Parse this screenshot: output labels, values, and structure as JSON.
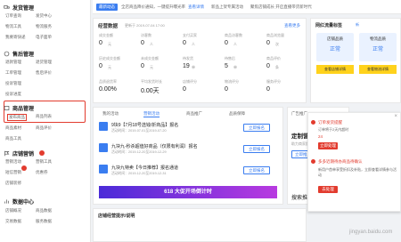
{
  "sidebar": {
    "sections": [
      {
        "title": "发货管理",
        "items": [
          "订单查询",
          "发货中心",
          "物流工具",
          "物流服务",
          "我要寄快递",
          "电子面单"
        ]
      },
      {
        "title": "售后管理",
        "items": [
          "退款管理",
          "退货管理",
          "工单管理",
          "售后评价",
          "投诉管理",
          "投诉进度"
        ]
      },
      {
        "title": "商品管理",
        "items": [
          "发布商品",
          "商品列表",
          "商品素材",
          "商品评价",
          "商品工具"
        ]
      },
      {
        "title": "店铺营销",
        "items": [
          "营销活动",
          "营销工具",
          "短信营销",
          "优惠券",
          "店铺装修"
        ]
      },
      {
        "title": "数据中心",
        "items": [
          "店铺概况",
          "商品数据",
          "交易数据",
          "服务数据"
        ]
      }
    ]
  },
  "topbar": {
    "tag": "最新动态",
    "text": "全店商品降价通知，一键提升曝光率",
    "link": "查看详情",
    "extra": "新品上架专属活动",
    "right": "聚焦店铺成长 开启直播带货新时代"
  },
  "overview": {
    "title": "经营数据",
    "time": "更新于 2019-07-04 17:00",
    "link": "查看更多",
    "row1": [
      {
        "label": "成交金额",
        "value": "0",
        "unit": "元"
      },
      {
        "label": "访客数",
        "value": "0",
        "unit": "人"
      },
      {
        "label": "支付买家",
        "value": "0",
        "unit": "人"
      },
      {
        "label": "商品访客数",
        "value": "0",
        "unit": "人"
      },
      {
        "label": "商品浏览量",
        "value": "0",
        "unit": "次"
      }
    ],
    "row2": [
      {
        "label": "历史成交金额",
        "value": "0",
        "unit": "元"
      },
      {
        "label": "未成交金额",
        "value": "0",
        "unit": "元"
      },
      {
        "label": "待发货",
        "value": "19",
        "unit": "单"
      },
      {
        "label": "待售后",
        "value": "5",
        "unit": "单"
      },
      {
        "label": "商品评价",
        "value": "0",
        "unit": "条"
      }
    ],
    "row3": [
      {
        "label": "品质退货率",
        "value": "0.00%"
      },
      {
        "label": "平均发货时长",
        "value": "0.00天"
      },
      {
        "label": "店铺评分",
        "value": "0"
      },
      {
        "label": "物流评分",
        "value": "0"
      },
      {
        "label": "服务评分",
        "value": "0"
      }
    ]
  },
  "score": {
    "title": "网红流量标签",
    "badge": "新",
    "left_title": "店铺品质",
    "left_status": "正常",
    "right_title": "物流品质",
    "right_status": "正常",
    "link_left": "查看店铺详情",
    "link_right": "查看物流详情"
  },
  "activity": {
    "tabs": [
      "我的活动",
      "营销活动",
      "商品推广",
      "品质保障"
    ],
    "items": [
      {
        "title": "9块9【7月18号选钱/折商品】报名",
        "date": "活动时间：2019-07-01至2019-07-20",
        "btn": "立即报名"
      },
      {
        "title": "九块九-秒杀超值好商品（仅限有利润）报名",
        "date": "活动时间：2019-12-20至2019-12-29",
        "btn": "立即报名"
      },
      {
        "title": "九块九特卖【今日推荐】报名通道",
        "date": "活动时间：2019-12-20至2019-12-31",
        "btn": "立即报名"
      }
    ],
    "banner": "618 大促开场倒计时"
  },
  "ad": {
    "title": "广告推广",
    "promo": "定制营销工具",
    "sub": "助力商家提升转化率",
    "btn": "立即推广",
    "search": "搜索推广"
  },
  "notice": {
    "title": "订单发货提醒",
    "sub": "订单将于2天内超时",
    "count": "24",
    "btn": "立即处理",
    "title2": "多多近期待办商品待确认",
    "text2": "新用户首单享受折扣及补贴，立即查看详情参与活动",
    "btn2": "去处理",
    "close": "×"
  },
  "bottom": {
    "title": "店铺经营提示/说明"
  },
  "watermark": "jingyan.baidu.com"
}
